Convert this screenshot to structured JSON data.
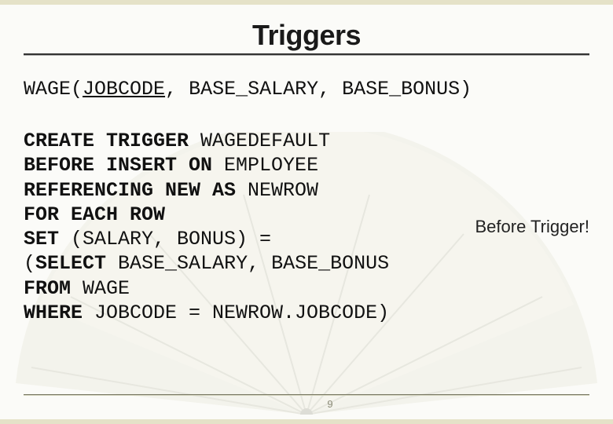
{
  "title": "Triggers",
  "schema": {
    "table": "WAGE",
    "pk": "JOBCODE",
    "col2": "BASE_SALARY",
    "col3": "BASE_BONUS"
  },
  "code": {
    "l1a": "CREATE TRIGGER ",
    "l1b": "WAGEDEFAULT",
    "l2a": "BEFORE INSERT ON ",
    "l2b": "EMPLOYEE",
    "l3a": "REFERENCING NEW AS ",
    "l3b": "NEWROW",
    "l4": "FOR EACH ROW",
    "l5a": "SET ",
    "l5b": "(SALARY, BONUS) =",
    "l6a": "(",
    "l6b": "SELECT ",
    "l6c": "BASE_SALARY, BASE_BONUS",
    "l7a": "FROM ",
    "l7b": "WAGE",
    "l8a": "WHERE ",
    "l8b": "JOBCODE = NEWROW.JOBCODE)"
  },
  "annotation": "Before Trigger!",
  "page_number": "9"
}
